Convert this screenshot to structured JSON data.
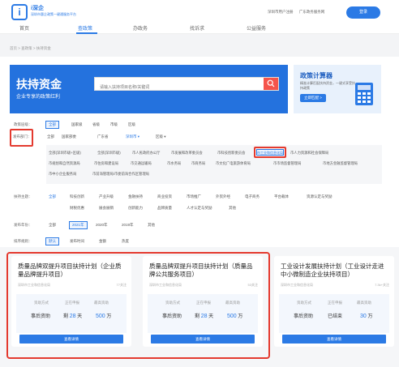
{
  "header": {
    "logo_mark": "i",
    "logo_name": "i深企",
    "logo_sub": "深圳市惠企政策一键通服务平台",
    "links": [
      "深圳市用户注册",
      "广东政务服务网"
    ],
    "login_label": "登录"
  },
  "nav": {
    "items": [
      "首页",
      "查政策",
      "办政务",
      "找诉求",
      "公益服务"
    ],
    "active_index": 1
  },
  "breadcrumb": "首页 > 查政策 > 扶持资金",
  "banner": {
    "title": "扶持资金",
    "subtitle": "企业专享的政策红利",
    "search_placeholder": "请输入扶持项目名称/关键词"
  },
  "calculator": {
    "title": "政策计算器",
    "subtitle": "精准计算匹配扶持资金，一键式享受扶持政策",
    "button": "立即匹配 >"
  },
  "filters": {
    "level": {
      "label": "政策层级：",
      "options": [
        "全部",
        "国家级",
        "省级",
        "市级",
        "区级"
      ],
      "selected": "全部"
    },
    "dept": {
      "label": "发布部门：",
      "options": [
        "全部",
        "国家部委",
        "广东省",
        "深圳市",
        "区级"
      ],
      "selected": "全部",
      "sub_items": [
        [
          "全部(深圳市级+区级)",
          "全部(深圳市级)",
          "市人民政府办公厅",
          "市发展和改革委员会",
          "市科技创新委员会",
          "市工业和信息化局",
          "市人力资源和社会保障局"
        ],
        [
          "市规划和自然资源局",
          "市住房和建设局",
          "市交通运输局",
          "市水务局",
          "市商务局",
          "市文化广电旅游体育局",
          "市市场监督管理局",
          "市地方金融监督管理局"
        ],
        [
          "市中小企业服务局",
          "市前海管理局/市委前海合作区管理局"
        ]
      ],
      "sub_selected": "市工业和信息化局"
    },
    "topic": {
      "label": "扶持主题：",
      "options": [
        "全部",
        "科技创新",
        "产业升级",
        "金融扶持",
        "商业投资",
        "市场推广",
        "外贸外经",
        "电子商务",
        "平台载体",
        "资源认定与奖励"
      ],
      "options_row2": [
        "财税优惠",
        "展会展销",
        "创新能力",
        "品牌质量",
        "人才认定与奖励",
        "其他"
      ]
    },
    "year": {
      "label": "发布年份：",
      "options": [
        "全部",
        "2021年",
        "2020年",
        "2019年",
        "其他"
      ],
      "selected": "2021年"
    },
    "sort": {
      "label": "排序规则：",
      "options": [
        "默认",
        "发布时间",
        "金额",
        "热度"
      ],
      "selected": "默认"
    }
  },
  "cards": [
    {
      "title": "质量品牌双提升项目扶持计划（企业质量品牌提升项目）",
      "dept": "深圳市工业和信息化局",
      "views": "77关注",
      "info_headers": [
        "资助方式",
        "正在申报",
        "最高资助"
      ],
      "mode": "事后资助",
      "days_prefix": "剩",
      "days": "28",
      "days_unit": "天",
      "amount": "500",
      "amount_unit": "万",
      "button": "查看详情"
    },
    {
      "title": "质量品牌双提升项目扶持计划（质量品牌公共服务项目）",
      "dept": "深圳市工业和信息化局",
      "views": "53关注",
      "info_headers": [
        "资助方式",
        "正在申报",
        "最高资助"
      ],
      "mode": "事后资助",
      "days_prefix": "剩",
      "days": "28",
      "days_unit": "天",
      "amount": "500",
      "amount_unit": "万",
      "button": "查看详情"
    },
    {
      "title": "工业设计发展扶持计划（工业设计走进中小微制造企业扶持项目）",
      "dept": "深圳市工业和信息化局",
      "views": "7.3k+关注",
      "info_headers": [
        "资助方式",
        "正在申报",
        "最高资助"
      ],
      "mode": "事后资助",
      "days_prefix": "",
      "days": "已结束",
      "days_unit": "",
      "amount": "30",
      "amount_unit": "万",
      "button": "查看详情"
    }
  ]
}
